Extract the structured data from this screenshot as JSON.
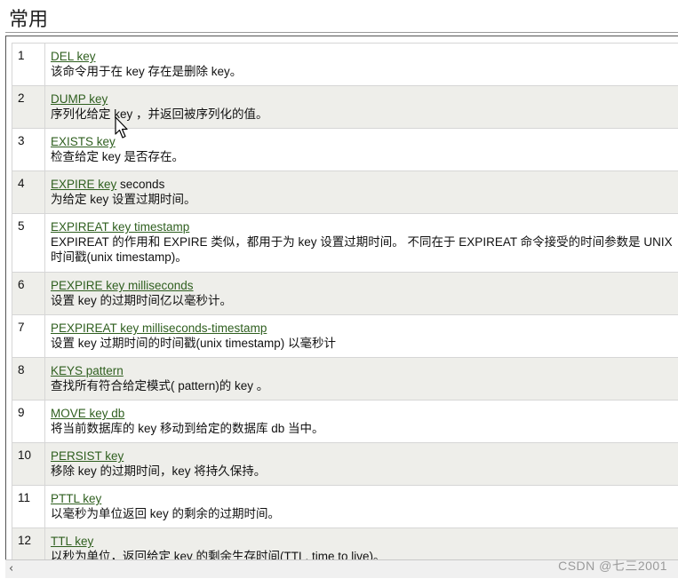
{
  "header": {
    "title": "常用"
  },
  "commands": [
    {
      "num": "1",
      "cmd": "DEL key",
      "args": "",
      "desc": "该命令用于在 key 存在是删除 key。"
    },
    {
      "num": "2",
      "cmd": "DUMP key",
      "args": "",
      "desc": "序列化给定 key ，并返回被序列化的值。"
    },
    {
      "num": "3",
      "cmd": "EXISTS key",
      "args": "",
      "desc": "检查给定 key 是否存在。"
    },
    {
      "num": "4",
      "cmd": "EXPIRE key",
      "args": " seconds",
      "desc": "为给定 key 设置过期时间。"
    },
    {
      "num": "5",
      "cmd": "EXPIREAT key timestamp",
      "args": "",
      "desc": "EXPIREAT 的作用和 EXPIRE 类似，都用于为 key 设置过期时间。 不同在于 EXPIREAT 命令接受的时间参数是 UNIX 时间戳(unix timestamp)。"
    },
    {
      "num": "6",
      "cmd": "PEXPIRE key milliseconds",
      "args": "",
      "desc": "设置 key 的过期时间亿以毫秒计。"
    },
    {
      "num": "7",
      "cmd": "PEXPIREAT key milliseconds-timestamp",
      "args": "",
      "desc": "设置 key 过期时间的时间戳(unix timestamp) 以毫秒计"
    },
    {
      "num": "8",
      "cmd": "KEYS pattern",
      "args": "",
      "desc": "查找所有符合给定模式( pattern)的 key 。"
    },
    {
      "num": "9",
      "cmd": "MOVE key db",
      "args": "",
      "desc": "将当前数据库的 key 移动到给定的数据库 db 当中。"
    },
    {
      "num": "10",
      "cmd": "PERSIST key",
      "args": "",
      "desc": "移除 key 的过期时间，key 将持久保持。"
    },
    {
      "num": "11",
      "cmd": "PTTL key",
      "args": "",
      "desc": "以毫秒为单位返回 key 的剩余的过期时间。"
    },
    {
      "num": "12",
      "cmd": "TTL key",
      "args": "",
      "desc": "以秒为单位，返回给定 key 的剩余生存时间(TTL, time to live)。"
    }
  ],
  "scrollbar": {
    "left_arrow": "‹"
  },
  "watermark": "CSDN @七三2001"
}
